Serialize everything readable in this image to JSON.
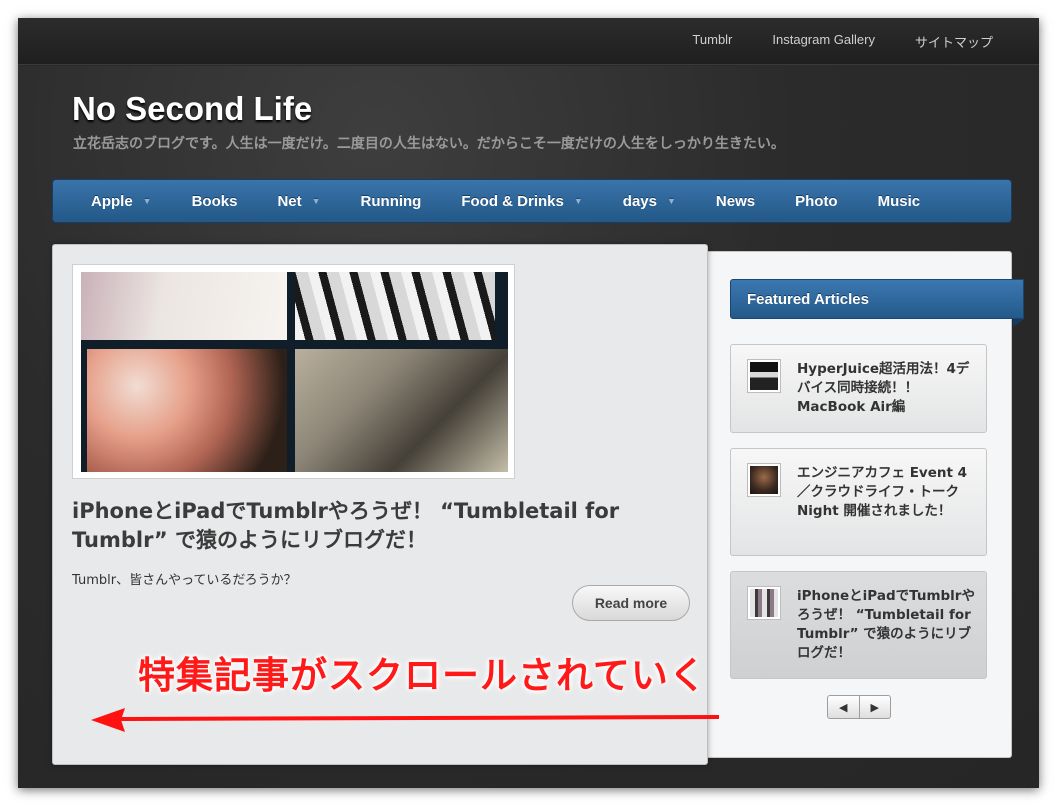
{
  "toplinks": [
    "Tumblr",
    "Instagram Gallery",
    "サイトマップ"
  ],
  "site": {
    "title": "No Second Life",
    "tagline": "立花岳志のブログです。人生は一度だけ。二度目の人生はない。だからこそ一度だけの人生をしっかり生きたい。"
  },
  "nav": [
    {
      "label": "Apple",
      "dropdown": true
    },
    {
      "label": "Books",
      "dropdown": false
    },
    {
      "label": "Net",
      "dropdown": true
    },
    {
      "label": "Running",
      "dropdown": false
    },
    {
      "label": "Food & Drinks",
      "dropdown": true
    },
    {
      "label": "days",
      "dropdown": true
    },
    {
      "label": "News",
      "dropdown": false
    },
    {
      "label": "Photo",
      "dropdown": false
    },
    {
      "label": "Music",
      "dropdown": false
    }
  ],
  "featured": {
    "title": "iPhoneとiPadでTumblrやろうぜ！ “Tumbletail for Tumblr” で猿のようにリブログだ！",
    "excerpt": "Tumblr、皆さんやっているだろうか？",
    "read_more": "Read more"
  },
  "annotation": "特集記事がスクロールされていく",
  "sidebar": {
    "header": "Featured Articles",
    "items": [
      {
        "text": "HyperJuice超活用法！4デバイス同時接続！！MacBook Air編"
      },
      {
        "text": "エンジニアカフェ Event 4／クラウドライフ・トークNight 開催されました！"
      },
      {
        "text": "iPhoneとiPadでTumblrやろうぜ！ “Tumbletail for Tumblr” で猿のようにリブログだ！"
      }
    ],
    "pager": {
      "prev": "◀",
      "next": "▶"
    }
  },
  "colors": {
    "nav_blue": "#2e6a9f",
    "annotation_red": "#ff1a1a"
  },
  "icons": [
    "chevron-down-icon",
    "prev-arrow-icon",
    "next-arrow-icon",
    "left-arrow-annotation-icon"
  ]
}
